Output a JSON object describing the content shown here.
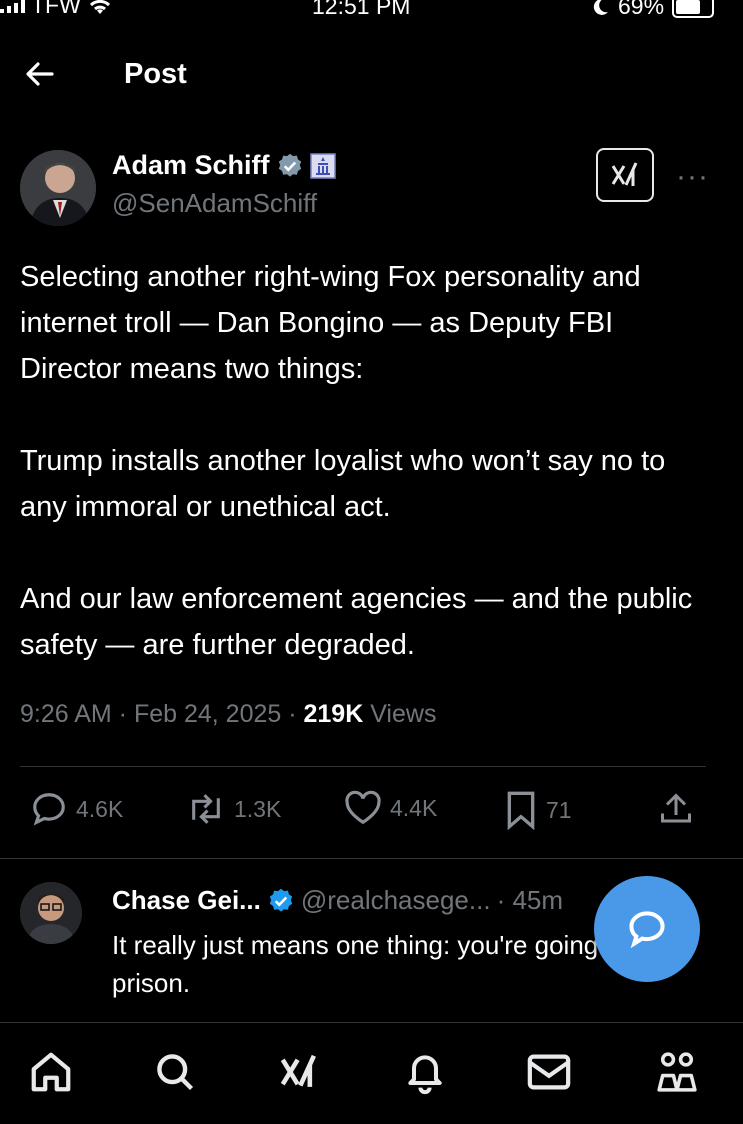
{
  "status_bar": {
    "carrier": "TFW",
    "time": "12:51 PM",
    "battery": "69%"
  },
  "header": {
    "title": "Post"
  },
  "post": {
    "author_name": "Adam Schiff",
    "author_handle": "@SenAdamSchiff",
    "paragraphs": [
      "Selecting another right-wing Fox personality and internet troll — Dan Bongino — as Deputy FBI Director means two things:",
      "Trump installs another loyalist who won’t say no to any immoral or unethical act.",
      "And our law enforcement agencies — and the public safety — are further degraded."
    ],
    "timestamp": "9:26 AM · Feb 24, 2025 · ",
    "views_count": "219K",
    "views_label": " Views"
  },
  "actions": {
    "replies": "4.6K",
    "reposts": "1.3K",
    "likes": "4.4K",
    "bookmarks": "71"
  },
  "reply": {
    "author_name": "Chase Gei...",
    "author_handle": "@realchasege...",
    "time": "· 45m",
    "text": "It really just means one thing: you're going to prison."
  },
  "colors": {
    "background": "#000000",
    "text": "#e7e9ea",
    "muted": "#71767b",
    "verified": "#1d9bf0",
    "fab": "#4a99e9"
  },
  "icons": [
    "back-arrow-icon",
    "verified-badge-icon",
    "government-badge-icon",
    "grok-icon",
    "more-icon",
    "reply-icon",
    "repost-icon",
    "like-icon",
    "bookmark-icon",
    "share-icon",
    "compose-icon",
    "home-icon",
    "search-icon",
    "notifications-icon",
    "messages-icon",
    "communities-icon"
  ]
}
